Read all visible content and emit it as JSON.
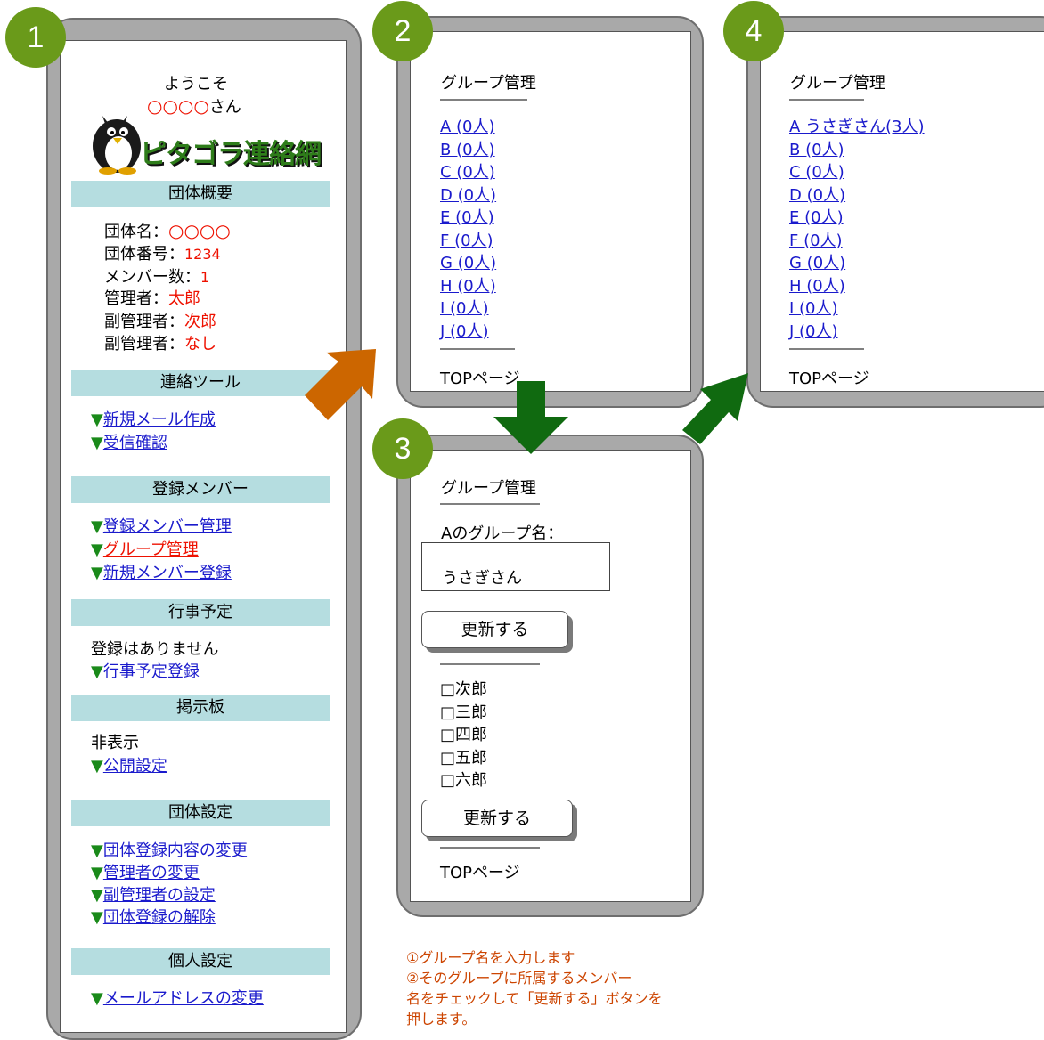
{
  "steps": [
    "1",
    "2",
    "3",
    "4"
  ],
  "phone1": {
    "welcome": "ようこそ",
    "username": "○○○○",
    "username_suffix": "さん",
    "logo_text": "ピタゴラ連絡網",
    "sections": {
      "overview": "団体概要",
      "tools": "連絡ツール",
      "members": "登録メンバー",
      "events": "行事予定",
      "board": "掲示板",
      "group_settings": "団体設定",
      "personal": "個人設定"
    },
    "overview": {
      "name_label": "団体名：",
      "name_value": "○○○○",
      "number_label": "団体番号：",
      "number_value": "1234",
      "count_label": "メンバー数：",
      "count_value": "1",
      "admin_label": "管理者：",
      "admin_value": "太郎",
      "subadmin1_label": "副管理者：",
      "subadmin1_value": "次郎",
      "subadmin2_label": "副管理者：",
      "subadmin2_value": "なし"
    },
    "bullet": "▼",
    "tools_links": [
      "新規メール作成",
      "受信確認"
    ],
    "member_links": [
      "登録メンバー管理",
      "グループ管理",
      "新規メンバー登録"
    ],
    "events_text": "登録はありません",
    "events_link": "行事予定登録",
    "board_text": "非表示",
    "board_link": "公開設定",
    "settings_links": [
      "団体登録内容の変更",
      "管理者の変更",
      "副管理者の設定",
      "団体登録の解除"
    ],
    "personal_link": "メールアドレスの変更"
  },
  "phone2": {
    "title": "グループ管理",
    "divider_top": "―――――――",
    "groups": [
      "A (0人)",
      "B (0人)",
      "C (0人)",
      "D (0人)",
      "E (0人)",
      "F (0人)",
      "G (0人)",
      "H (0人)",
      "I (0人)",
      "J (0人)"
    ],
    "divider_bottom": "――――――",
    "top_link": "TOPページ"
  },
  "phone3": {
    "title": "グループ管理",
    "divider1": "――――――――",
    "label": "Aのグループ名：",
    "input_value": "うさぎさん",
    "update_button": "更新する",
    "divider2": "――――――――",
    "checkbox_glyph": "□",
    "members": [
      "次郎",
      "三郎",
      "四郎",
      "五郎",
      "六郎"
    ],
    "update_button2": "更新する",
    "divider3": "――――――――",
    "top_link": "TOPページ"
  },
  "phone4": {
    "title": "グループ管理",
    "divider_top": "――――――",
    "groups": [
      "A うさぎさん(3人)",
      "B (0人)",
      "C (0人)",
      "D (0人)",
      "E (0人)",
      "F (0人)",
      "G (0人)",
      "H (0人)",
      "I (0人)",
      "J (0人)"
    ],
    "divider_bottom": "――――――",
    "top_link": "TOPページ"
  },
  "note": {
    "line1": "①グループ名を入力します",
    "line2": "②そのグループに所属するメンバー",
    "line3": "名をチェックして「更新する」ボタンを",
    "line4": "押します。"
  },
  "colors": {
    "badge_green": "#6a9a1a",
    "section_header": "#b5dde0",
    "arrow_orange": "#cc6600",
    "arrow_green": "#106a10",
    "link_blue": "#1a1acc",
    "accent_red": "#ee1100",
    "note_orange": "#cc4400"
  }
}
